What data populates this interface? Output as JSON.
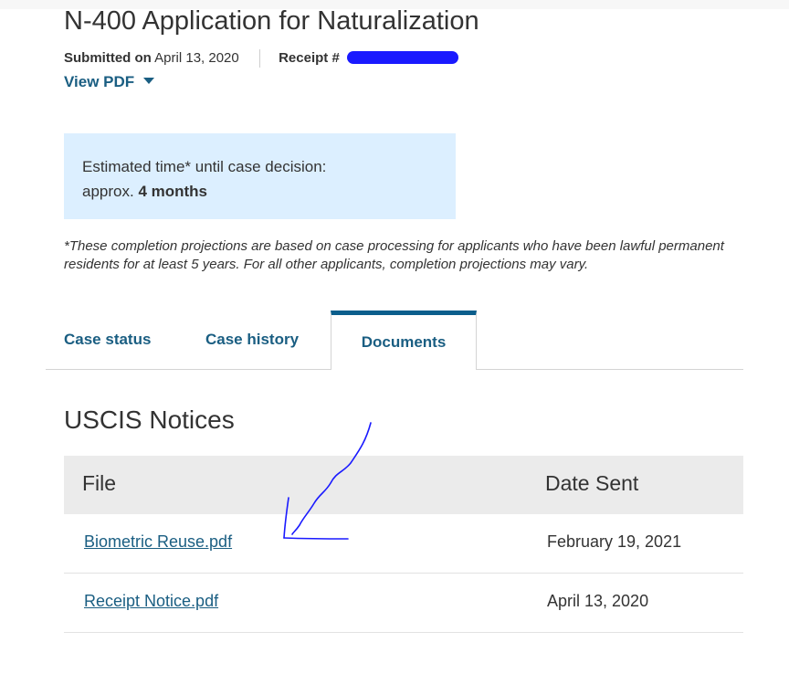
{
  "header": {
    "title": "N-400 Application for Naturalization",
    "submitted_label": "Submitted on",
    "submitted_date": "April 13, 2020",
    "receipt_label": "Receipt #",
    "view_pdf_label": "View PDF"
  },
  "estimate": {
    "line1": "Estimated time* until case decision:",
    "prefix": "approx.",
    "value": "4 months"
  },
  "disclaimer": "*These completion projections are based on case processing for applicants who have been lawful permanent residents for at least 5 years. For all other applicants, completion projections may vary.",
  "tabs": [
    {
      "label": "Case status"
    },
    {
      "label": "Case history"
    },
    {
      "label": "Documents"
    }
  ],
  "notices": {
    "title": "USCIS Notices",
    "columns": [
      "File",
      "Date Sent"
    ],
    "rows": [
      {
        "file": "Biometric Reuse.pdf",
        "date": "February 19, 2021"
      },
      {
        "file": "Receipt Notice.pdf",
        "date": "April 13, 2020"
      }
    ]
  },
  "colors": {
    "link": "#1a5e82",
    "active_tab_border": "#0b5e8c",
    "estimate_bg": "#dcefff",
    "annotation_ink": "#1a1aff"
  }
}
